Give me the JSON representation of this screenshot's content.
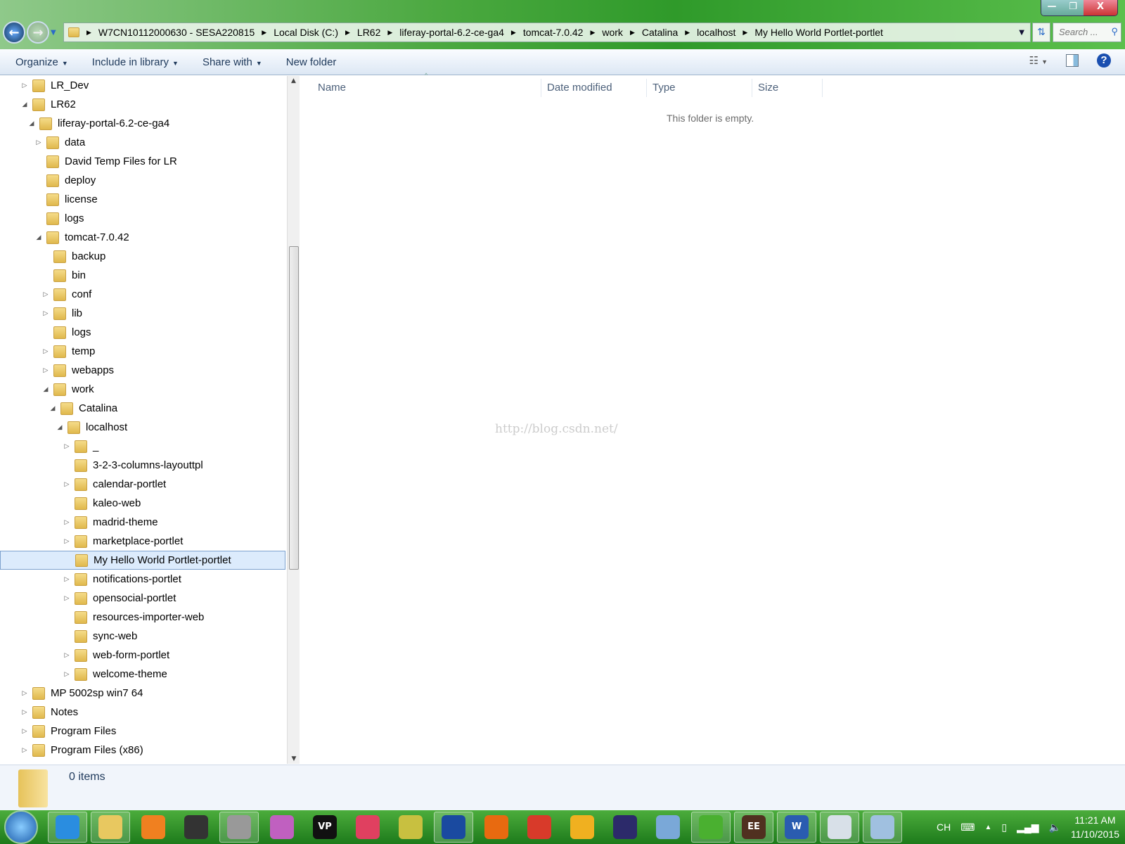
{
  "window": {
    "minimize": "—",
    "restore": "❐",
    "close": "X"
  },
  "address": {
    "crumbs": [
      "W7CN10112000630 - SESA220815",
      "Local Disk (C:)",
      "LR62",
      "liferay-portal-6.2-ce-ga4",
      "tomcat-7.0.42",
      "work",
      "Catalina",
      "localhost",
      "My Hello World Portlet-portlet"
    ]
  },
  "search": {
    "placeholder": "Search ..."
  },
  "toolbar": {
    "organize": "Organize",
    "include": "Include in library",
    "share": "Share with",
    "new_folder": "New folder"
  },
  "tree": [
    {
      "label": "LR_Dev",
      "level": 0,
      "arrow": "▷"
    },
    {
      "label": "LR62",
      "level": 0,
      "arrow": "◢"
    },
    {
      "label": "liferay-portal-6.2-ce-ga4",
      "level": 1,
      "arrow": "◢"
    },
    {
      "label": "data",
      "level": 2,
      "arrow": "▷"
    },
    {
      "label": "David Temp Files for LR",
      "level": 2,
      "arrow": ""
    },
    {
      "label": "deploy",
      "level": 2,
      "arrow": ""
    },
    {
      "label": "license",
      "level": 2,
      "arrow": ""
    },
    {
      "label": "logs",
      "level": 2,
      "arrow": ""
    },
    {
      "label": "tomcat-7.0.42",
      "level": 2,
      "arrow": "◢"
    },
    {
      "label": "backup",
      "level": 3,
      "arrow": ""
    },
    {
      "label": "bin",
      "level": 3,
      "arrow": ""
    },
    {
      "label": "conf",
      "level": 3,
      "arrow": "▷"
    },
    {
      "label": "lib",
      "level": 3,
      "arrow": "▷"
    },
    {
      "label": "logs",
      "level": 3,
      "arrow": ""
    },
    {
      "label": "temp",
      "level": 3,
      "arrow": "▷"
    },
    {
      "label": "webapps",
      "level": 3,
      "arrow": "▷"
    },
    {
      "label": "work",
      "level": 3,
      "arrow": "◢"
    },
    {
      "label": "Catalina",
      "level": 4,
      "arrow": "◢"
    },
    {
      "label": "localhost",
      "level": 5,
      "arrow": "◢"
    },
    {
      "label": "_",
      "level": 6,
      "arrow": "▷"
    },
    {
      "label": "3-2-3-columns-layouttpl",
      "level": 6,
      "arrow": ""
    },
    {
      "label": "calendar-portlet",
      "level": 6,
      "arrow": "▷"
    },
    {
      "label": "kaleo-web",
      "level": 6,
      "arrow": ""
    },
    {
      "label": "madrid-theme",
      "level": 6,
      "arrow": "▷"
    },
    {
      "label": "marketplace-portlet",
      "level": 6,
      "arrow": "▷"
    },
    {
      "label": "My Hello World Portlet-portlet",
      "level": 6,
      "arrow": "",
      "selected": true
    },
    {
      "label": "notifications-portlet",
      "level": 6,
      "arrow": "▷"
    },
    {
      "label": "opensocial-portlet",
      "level": 6,
      "arrow": "▷"
    },
    {
      "label": "resources-importer-web",
      "level": 6,
      "arrow": ""
    },
    {
      "label": "sync-web",
      "level": 6,
      "arrow": ""
    },
    {
      "label": "web-form-portlet",
      "level": 6,
      "arrow": "▷"
    },
    {
      "label": "welcome-theme",
      "level": 6,
      "arrow": "▷"
    },
    {
      "label": "MP 5002sp win7 64",
      "level": 0,
      "arrow": "▷"
    },
    {
      "label": "Notes",
      "level": 0,
      "arrow": "▷"
    },
    {
      "label": "Program Files",
      "level": 0,
      "arrow": "▷"
    },
    {
      "label": "Program Files (x86)",
      "level": 0,
      "arrow": "▷"
    }
  ],
  "columns": {
    "name": "Name",
    "date": "Date modified",
    "type": "Type",
    "size": "Size"
  },
  "content": {
    "empty": "This folder is empty.",
    "watermark": "http://blog.csdn.net/"
  },
  "status": {
    "items": "0 items"
  },
  "taskbar": {
    "apps": [
      {
        "name": "internet-explorer",
        "color": "#2a8de0",
        "pinned": true
      },
      {
        "name": "file-explorer",
        "color": "#e8c860",
        "pinned": true
      },
      {
        "name": "media-player",
        "color": "#f08020",
        "pinned": false
      },
      {
        "name": "hypercam",
        "color": "#333333",
        "pinned": false
      },
      {
        "name": "bitlocker-drive",
        "color": "#999999",
        "pinned": true
      },
      {
        "name": "color-app",
        "color": "#c060c0",
        "pinned": false
      },
      {
        "name": "dxo-viewpoint",
        "color": "#111111",
        "pinned": false,
        "text": "VP"
      },
      {
        "name": "red-app",
        "color": "#e04060",
        "pinned": false
      },
      {
        "name": "toad",
        "color": "#c8c040",
        "pinned": false
      },
      {
        "name": "teamviewer",
        "color": "#1a4aa0",
        "pinned": true
      },
      {
        "name": "firefox",
        "color": "#e86a10",
        "pinned": false
      },
      {
        "name": "chrome",
        "color": "#d83a2a",
        "pinned": false
      },
      {
        "name": "yahoo-app",
        "color": "#f0b020",
        "pinned": false
      },
      {
        "name": "eclipse",
        "color": "#2c2a6a",
        "pinned": false
      },
      {
        "name": "virtualbox",
        "color": "#7aa8d8",
        "pinned": false
      },
      {
        "name": "wechat",
        "color": "#4ab030",
        "pinned": true
      },
      {
        "name": "eclipse-java-ee",
        "color": "#503020",
        "pinned": true,
        "text": "EE"
      },
      {
        "name": "word",
        "color": "#2a5cb0",
        "pinned": true,
        "text": "W"
      },
      {
        "name": "reader",
        "color": "#d8e0e8",
        "pinned": true
      },
      {
        "name": "paint",
        "color": "#a0c0e0",
        "pinned": true
      }
    ]
  },
  "tray": {
    "lang": "CH",
    "time": "11:21 AM",
    "date": "11/10/2015"
  }
}
